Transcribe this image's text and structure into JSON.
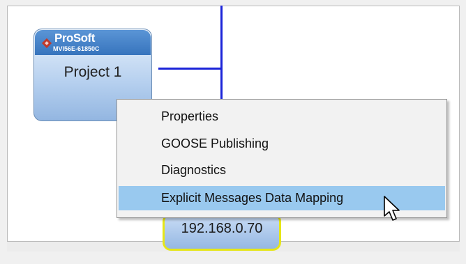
{
  "diagram": {
    "device_node": {
      "brand": "ProSoft",
      "model": "MVI56E-61850C",
      "label": "Project 1"
    },
    "ip_node": {
      "label": "192.168.0.70"
    },
    "connection_color": "#1b24d8",
    "highlight_border_color": "#e6e617"
  },
  "context_menu": {
    "items": [
      {
        "label": "Properties"
      },
      {
        "label": "GOOSE Publishing"
      },
      {
        "label": "Diagnostics"
      },
      {
        "label": "Explicit Messages Data Mapping",
        "highlighted": true
      }
    ],
    "highlight_color": "#99c9ef"
  },
  "cursor": {
    "icon": "arrow-pointer-icon"
  }
}
